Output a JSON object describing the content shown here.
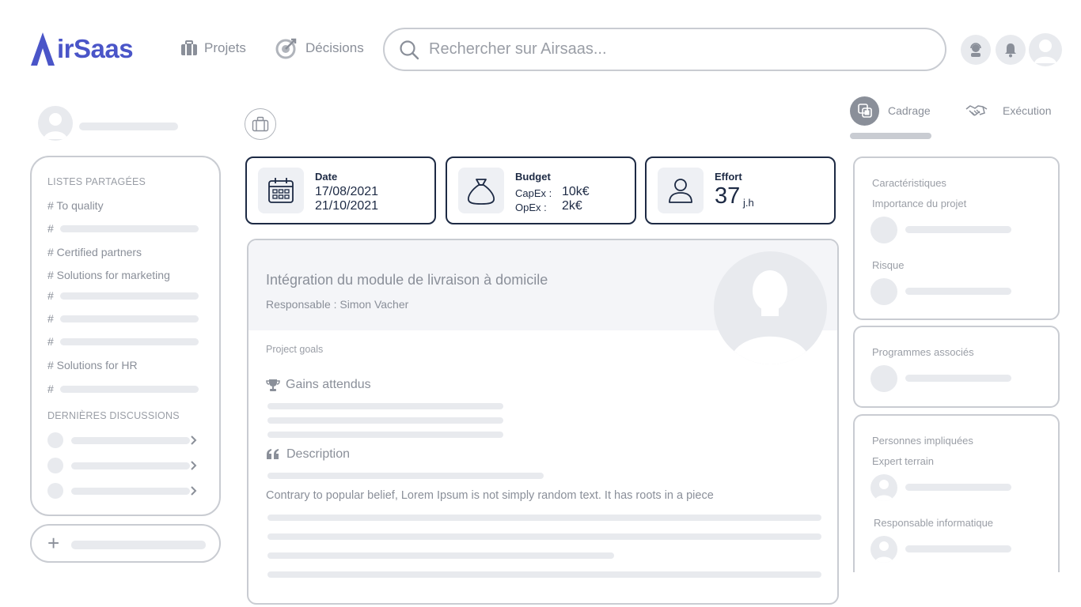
{
  "header": {
    "logo_text": "irSaas",
    "nav": [
      {
        "label": "Projets"
      },
      {
        "label": "Décisions"
      }
    ],
    "search_placeholder": "Rechercher sur Airsaas..."
  },
  "sidebar": {
    "shared_lists_heading": "LISTES PARTAGÉES",
    "items": [
      {
        "label": "# To quality"
      },
      {
        "label": "#"
      },
      {
        "label": "# Certified partners"
      },
      {
        "label": "# Solutions for marketing"
      },
      {
        "label": "#"
      },
      {
        "label": "#"
      },
      {
        "label": "#"
      },
      {
        "label": "# Solutions for HR"
      },
      {
        "label": "#"
      }
    ],
    "discussions_heading": "DERNIÈRES DISCUSSIONS",
    "add_label": "+"
  },
  "cards": {
    "date": {
      "title": "Date",
      "start": "17/08/2021",
      "end": "21/10/2021"
    },
    "budget": {
      "title": "Budget",
      "capex_label": "CapEx :",
      "capex_value": "10k€",
      "opex_label": "OpEx :",
      "opex_value": "2k€"
    },
    "effort": {
      "title": "Effort",
      "value": "37",
      "unit": "j.h"
    }
  },
  "project": {
    "title": "Intégration du module de livraison à domicile",
    "owner": "Responsable : Simon Vacher",
    "goals_label": "Project goals",
    "gains_label": "Gains attendus",
    "description_label": "Description",
    "description_text": "Contrary to popular belief, Lorem Ipsum is not simply random text. It has roots in a piece"
  },
  "tabs": [
    {
      "label": "Cadrage",
      "active": true
    },
    {
      "label": "Exécution",
      "active": false
    }
  ],
  "right": {
    "characteristics_heading": "Caractéristiques",
    "importance_label": "Importance du projet",
    "risk_label": "Risque",
    "programs_heading": "Programmes associés",
    "people_heading": "Personnes impliquées",
    "expert_label": "Expert terrain",
    "it_label": "Responsable informatique"
  },
  "colors": {
    "brand": "#4a55c8",
    "card_border": "#1d2a44",
    "panel_border": "#c9ccd2",
    "placeholder": "#e8eaee"
  }
}
